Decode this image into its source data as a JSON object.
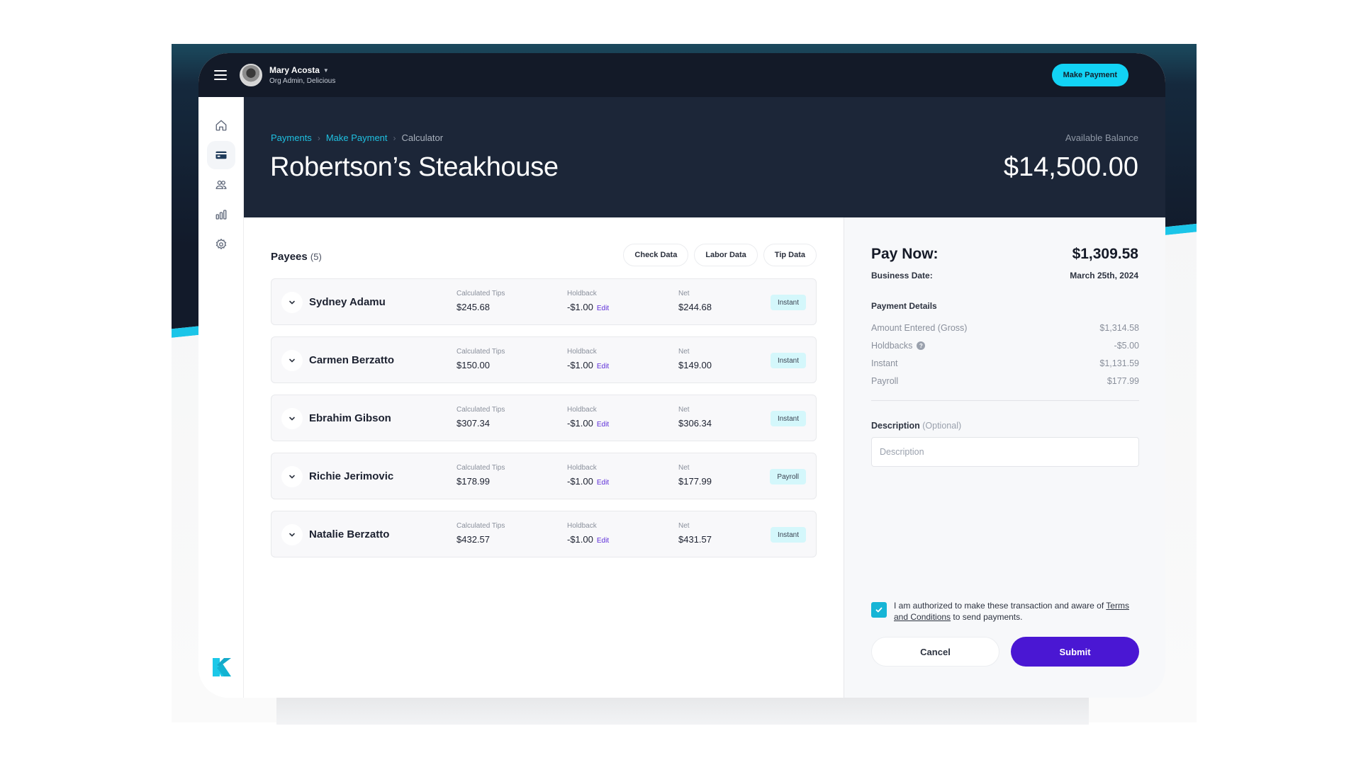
{
  "topbar": {
    "user_name": "Mary Acosta",
    "user_role": "Org Admin, Delicious",
    "make_payment_label": "Make Payment"
  },
  "sidebar": {
    "items": [
      {
        "icon": "home-icon",
        "active": false
      },
      {
        "icon": "credit-card-icon",
        "active": true
      },
      {
        "icon": "users-icon",
        "active": false
      },
      {
        "icon": "bar-chart-icon",
        "active": false
      },
      {
        "icon": "gear-icon",
        "active": false
      }
    ],
    "logo": "k-logo"
  },
  "header": {
    "breadcrumb": [
      "Payments",
      "Make Payment",
      "Calculator"
    ],
    "title": "Robertson’s Steakhouse",
    "balance_label": "Available Balance",
    "balance_value": "$14,500.00"
  },
  "payees": {
    "title": "Payees",
    "count": "(5)",
    "buttons": [
      "Check Data",
      "Labor Data",
      "Tip Data"
    ],
    "col_labels": {
      "tips": "Calculated Tips",
      "holdback": "Holdback",
      "net": "Net",
      "edit": "Edit"
    },
    "rows": [
      {
        "name": "Sydney Adamu",
        "tips": "$245.68",
        "holdback": "-$1.00",
        "net": "$244.68",
        "type": "Instant"
      },
      {
        "name": "Carmen Berzatto",
        "tips": "$150.00",
        "holdback": "-$1.00",
        "net": "$149.00",
        "type": "Instant"
      },
      {
        "name": "Ebrahim Gibson",
        "tips": "$307.34",
        "holdback": "-$1.00",
        "net": "$306.34",
        "type": "Instant"
      },
      {
        "name": "Richie Jerimovic",
        "tips": "$178.99",
        "holdback": "-$1.00",
        "net": "$177.99",
        "type": "Payroll"
      },
      {
        "name": "Natalie Berzatto",
        "tips": "$432.57",
        "holdback": "-$1.00",
        "net": "$431.57",
        "type": "Instant"
      }
    ]
  },
  "summary": {
    "pay_now_label": "Pay Now:",
    "pay_now_value": "$1,309.58",
    "business_date_label": "Business Date:",
    "business_date_value": "March 25th, 2024",
    "details_title": "Payment Details",
    "details": [
      {
        "label": "Amount Entered (Gross)",
        "value": "$1,314.58"
      },
      {
        "label": "Holdbacks",
        "value": "-$5.00"
      },
      {
        "label": "Instant",
        "value": "$1,131.59"
      },
      {
        "label": "Payroll",
        "value": "$177.99"
      }
    ],
    "description_label": "Description",
    "description_optional": "(Optional)",
    "description_placeholder": "Description",
    "description_value": "",
    "auth_text_1": "I am authorized to make these transaction and aware of ",
    "auth_link": "Terms and Conditions",
    "auth_text_2": " to send payments.",
    "auth_checked": true,
    "cancel_label": "Cancel",
    "submit_label": "Submit"
  },
  "colors": {
    "accent_cyan": "#12d3f5",
    "submit_purple": "#4a17d3",
    "header_dark": "#1c2638",
    "badge_bg": "#d4f7fb"
  }
}
